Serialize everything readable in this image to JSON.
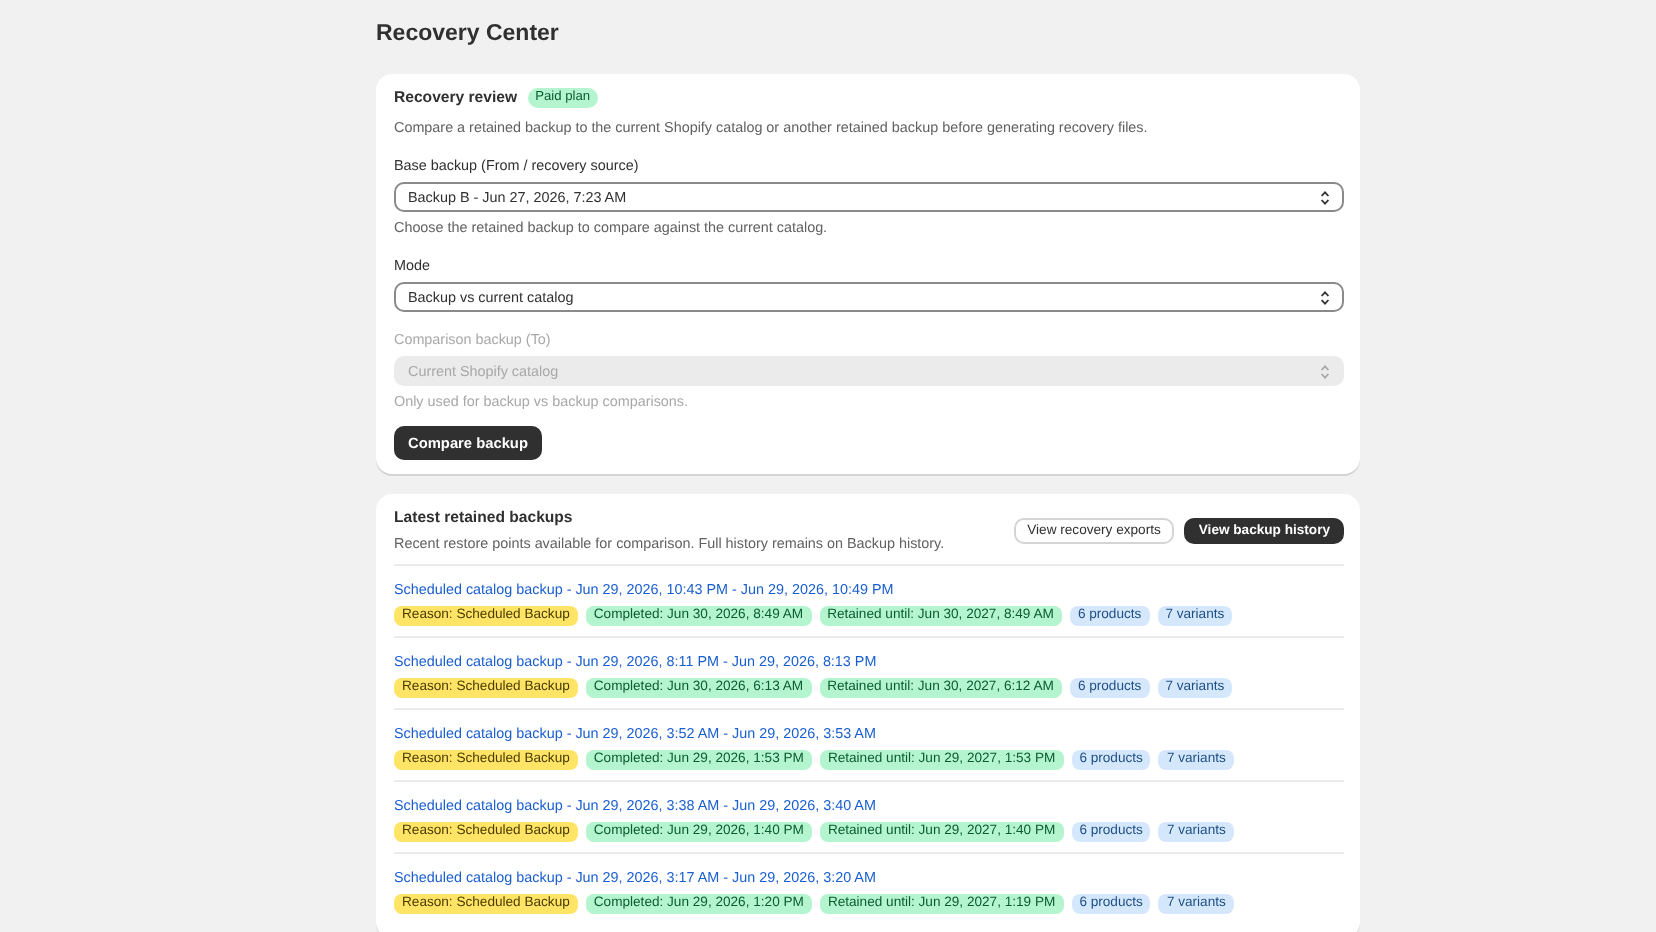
{
  "page_title": "Recovery Center",
  "review": {
    "title": "Recovery review",
    "badge": "Paid plan",
    "description": "Compare a retained backup to the current Shopify catalog or another retained backup before generating recovery files.",
    "fields": [
      {
        "label": "Base backup (From / recovery source)",
        "value": "Backup B - Jun 27, 2026, 7:23 AM",
        "help": "Choose the retained backup to compare against the current catalog.",
        "disabled": false
      },
      {
        "label": "Mode",
        "value": "Backup vs current catalog",
        "disabled": false
      },
      {
        "label": "Comparison backup (To)",
        "value": "Current Shopify catalog",
        "help": "Only used for backup vs backup comparisons.",
        "disabled": true
      }
    ],
    "button": "Compare backup"
  },
  "backups": {
    "title": "Latest retained backups",
    "description": "Recent restore points available for comparison. Full history remains on Backup history.",
    "buttons": [
      {
        "label": "View recovery exports",
        "kind": "secondary"
      },
      {
        "label": "View backup history",
        "kind": "primary"
      }
    ],
    "rows": [
      {
        "link": "Scheduled catalog backup - Jun 29, 2026, 10:43 PM - Jun 29, 2026, 10:49 PM",
        "tags": [
          {
            "text": "Reason: Scheduled Backup",
            "kind": "reason"
          },
          {
            "text": "Completed: Jun 30, 2026, 8:49 AM",
            "kind": "success"
          },
          {
            "text": "Retained until: Jun 30, 2027, 8:49 AM",
            "kind": "success"
          },
          {
            "text": "6 products",
            "kind": "info"
          },
          {
            "text": "7 variants",
            "kind": "info"
          }
        ]
      },
      {
        "link": "Scheduled catalog backup - Jun 29, 2026, 8:11 PM - Jun 29, 2026, 8:13 PM",
        "tags": [
          {
            "text": "Reason: Scheduled Backup",
            "kind": "reason"
          },
          {
            "text": "Completed: Jun 30, 2026, 6:13 AM",
            "kind": "success"
          },
          {
            "text": "Retained until: Jun 30, 2027, 6:12 AM",
            "kind": "success"
          },
          {
            "text": "6 products",
            "kind": "info"
          },
          {
            "text": "7 variants",
            "kind": "info"
          }
        ]
      },
      {
        "link": "Scheduled catalog backup - Jun 29, 2026, 3:52 AM - Jun 29, 2026, 3:53 AM",
        "tags": [
          {
            "text": "Reason: Scheduled Backup",
            "kind": "reason"
          },
          {
            "text": "Completed: Jun 29, 2026, 1:53 PM",
            "kind": "success"
          },
          {
            "text": "Retained until: Jun 29, 2027, 1:53 PM",
            "kind": "success"
          },
          {
            "text": "6 products",
            "kind": "info"
          },
          {
            "text": "7 variants",
            "kind": "info"
          }
        ]
      },
      {
        "link": "Scheduled catalog backup - Jun 29, 2026, 3:38 AM - Jun 29, 2026, 3:40 AM",
        "tags": [
          {
            "text": "Reason: Scheduled Backup",
            "kind": "reason"
          },
          {
            "text": "Completed: Jun 29, 2026, 1:40 PM",
            "kind": "success"
          },
          {
            "text": "Retained until: Jun 29, 2027, 1:40 PM",
            "kind": "success"
          },
          {
            "text": "6 products",
            "kind": "info"
          },
          {
            "text": "7 variants",
            "kind": "info"
          }
        ]
      },
      {
        "link": "Scheduled catalog backup - Jun 29, 2026, 3:17 AM - Jun 29, 2026, 3:20 AM",
        "tags": [
          {
            "text": "Reason: Scheduled Backup",
            "kind": "reason"
          },
          {
            "text": "Completed: Jun 29, 2026, 1:20 PM",
            "kind": "success"
          },
          {
            "text": "Retained until: Jun 29, 2027, 1:19 PM",
            "kind": "success"
          },
          {
            "text": "6 products",
            "kind": "info"
          },
          {
            "text": "7 variants",
            "kind": "info"
          }
        ]
      }
    ]
  }
}
